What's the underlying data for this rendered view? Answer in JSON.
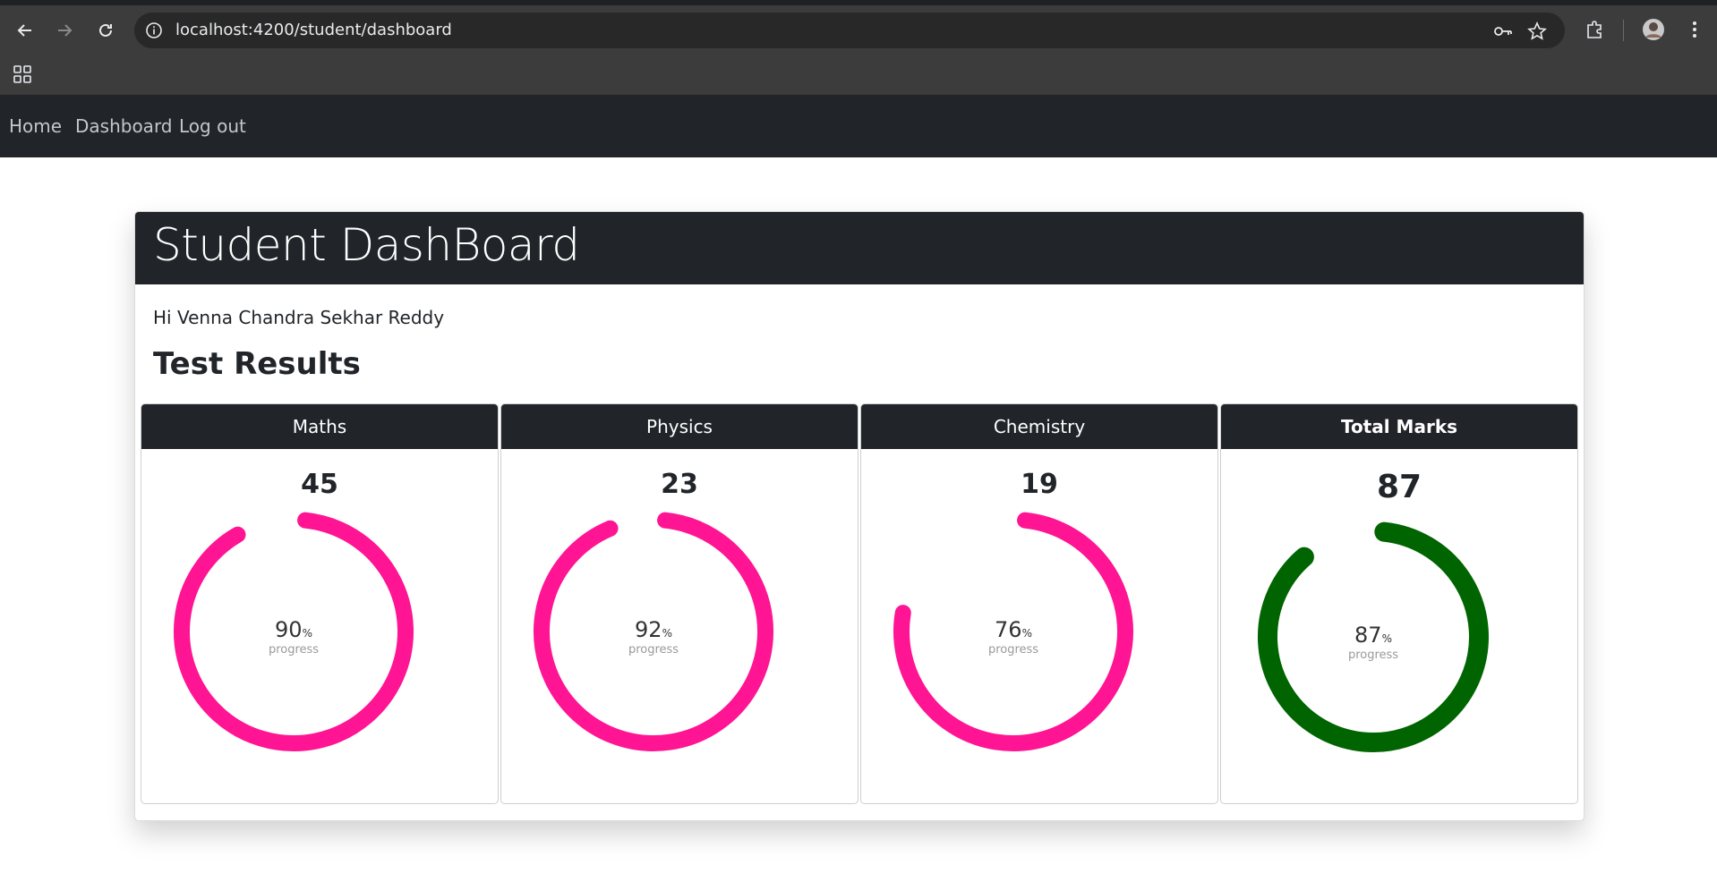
{
  "browser": {
    "url": "localhost:4200/student/dashboard",
    "back_icon": "arrow-left-icon",
    "forward_icon": "arrow-right-icon",
    "reload_icon": "reload-icon"
  },
  "nav": {
    "home": "Home",
    "dashboard": "Dashboard",
    "logout": "Log out"
  },
  "dashboard": {
    "title": "Student DashBoard",
    "greeting": "Hi Venna Chandra Sekhar Reddy",
    "section_title": "Test Results"
  },
  "results": [
    {
      "subject": "Maths",
      "score": "45",
      "percent": 90,
      "percent_label": "90",
      "unit": "%",
      "sub": "progress",
      "color": "#ff1493"
    },
    {
      "subject": "Physics",
      "score": "23",
      "percent": 92,
      "percent_label": "92",
      "unit": "%",
      "sub": "progress",
      "color": "#ff1493"
    },
    {
      "subject": "Chemistry",
      "score": "19",
      "percent": 76,
      "percent_label": "76",
      "unit": "%",
      "sub": "progress",
      "color": "#ff1493"
    },
    {
      "subject": "Total Marks",
      "score": "87",
      "percent": 87,
      "percent_label": "87",
      "unit": "%",
      "sub": "progress",
      "color": "#006400"
    }
  ]
}
